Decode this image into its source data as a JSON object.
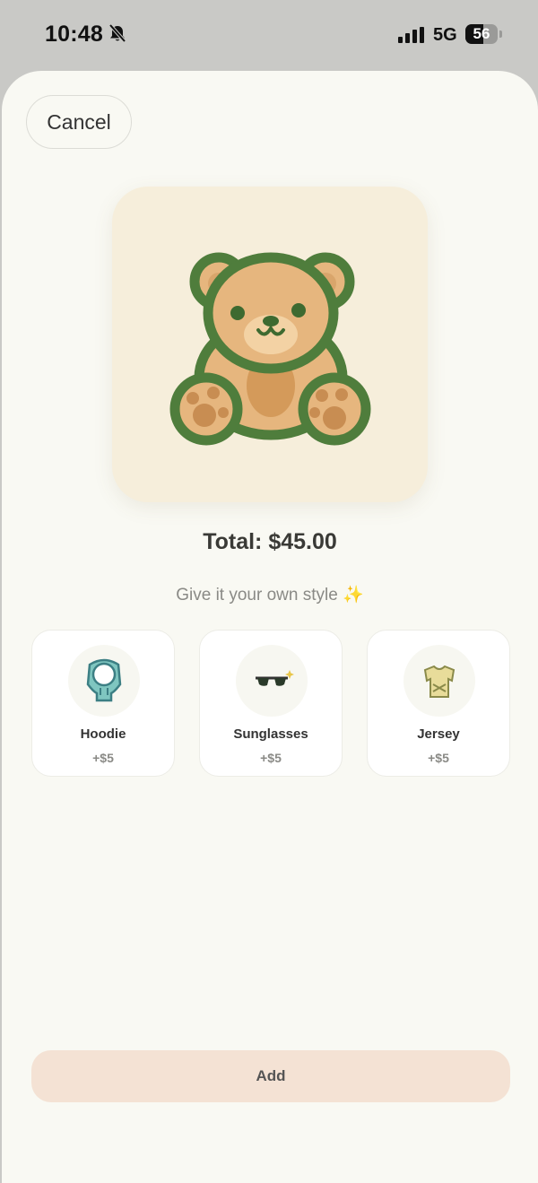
{
  "status_bar": {
    "time": "10:48",
    "network": "5G",
    "battery": "56",
    "battery_level_percent": 56
  },
  "header": {
    "cancel_label": "Cancel"
  },
  "product": {
    "image_icon": "teddy-bear-icon",
    "total_label": "Total: $45.00",
    "subtitle": "Give it your own style ✨"
  },
  "options": [
    {
      "name": "Hoodie",
      "price": "+$5",
      "icon": "hoodie-icon"
    },
    {
      "name": "Sunglasses",
      "price": "+$5",
      "icon": "sunglasses-icon"
    },
    {
      "name": "Jersey",
      "price": "+$5",
      "icon": "jersey-icon"
    }
  ],
  "footer": {
    "add_label": "Add"
  },
  "colors": {
    "sheet_background": "#f9f9f3",
    "hero_background": "#f6eedb",
    "bear_outline": "#4f7d3c",
    "bear_fur": "#e6b67e",
    "add_button": "#f4e2d4"
  }
}
